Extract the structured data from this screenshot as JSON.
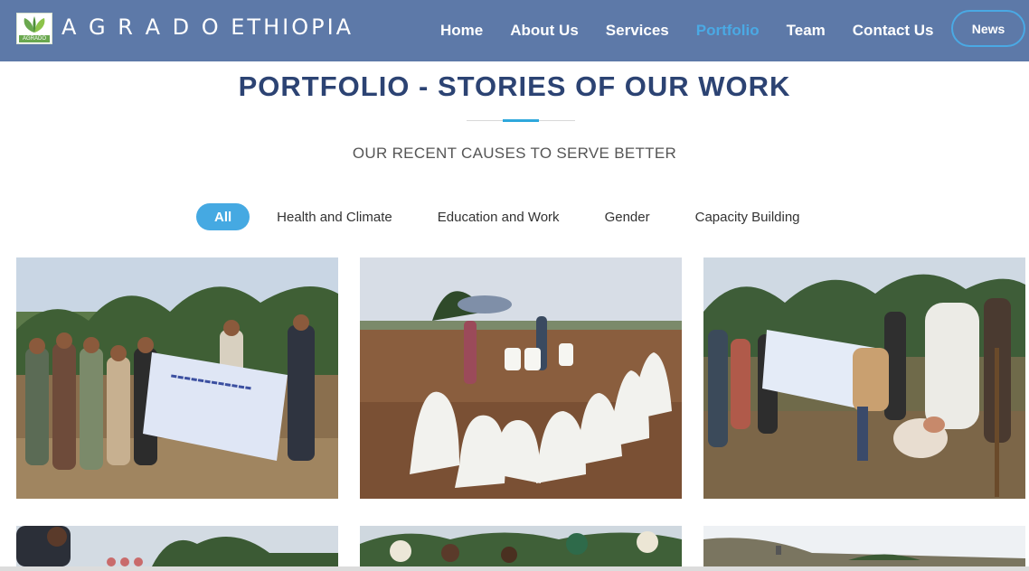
{
  "header": {
    "logo_caption": "AGRADO",
    "brand": "A G R A D O ETHIOPIA",
    "nav": [
      {
        "label": "Home",
        "active": false
      },
      {
        "label": "About Us",
        "active": false
      },
      {
        "label": "Services",
        "active": false
      },
      {
        "label": "Portfolio",
        "active": true
      },
      {
        "label": "Team",
        "active": false
      },
      {
        "label": "Contact Us",
        "active": false
      }
    ],
    "news_button": "News"
  },
  "main": {
    "title": "PORTFOLIO - STORIES OF OUR WORK",
    "subtitle": "OUR RECENT CAUSES TO SERVE BETTER",
    "filters": [
      {
        "label": "All",
        "active": true
      },
      {
        "label": "Health and Climate",
        "active": false
      },
      {
        "label": "Education and Work",
        "active": false
      },
      {
        "label": "Gender",
        "active": false
      },
      {
        "label": "Capacity Building",
        "active": false
      }
    ]
  },
  "colors": {
    "navbar": "#5d79a8",
    "accent": "#4aa9e4",
    "title": "#2c4373"
  }
}
